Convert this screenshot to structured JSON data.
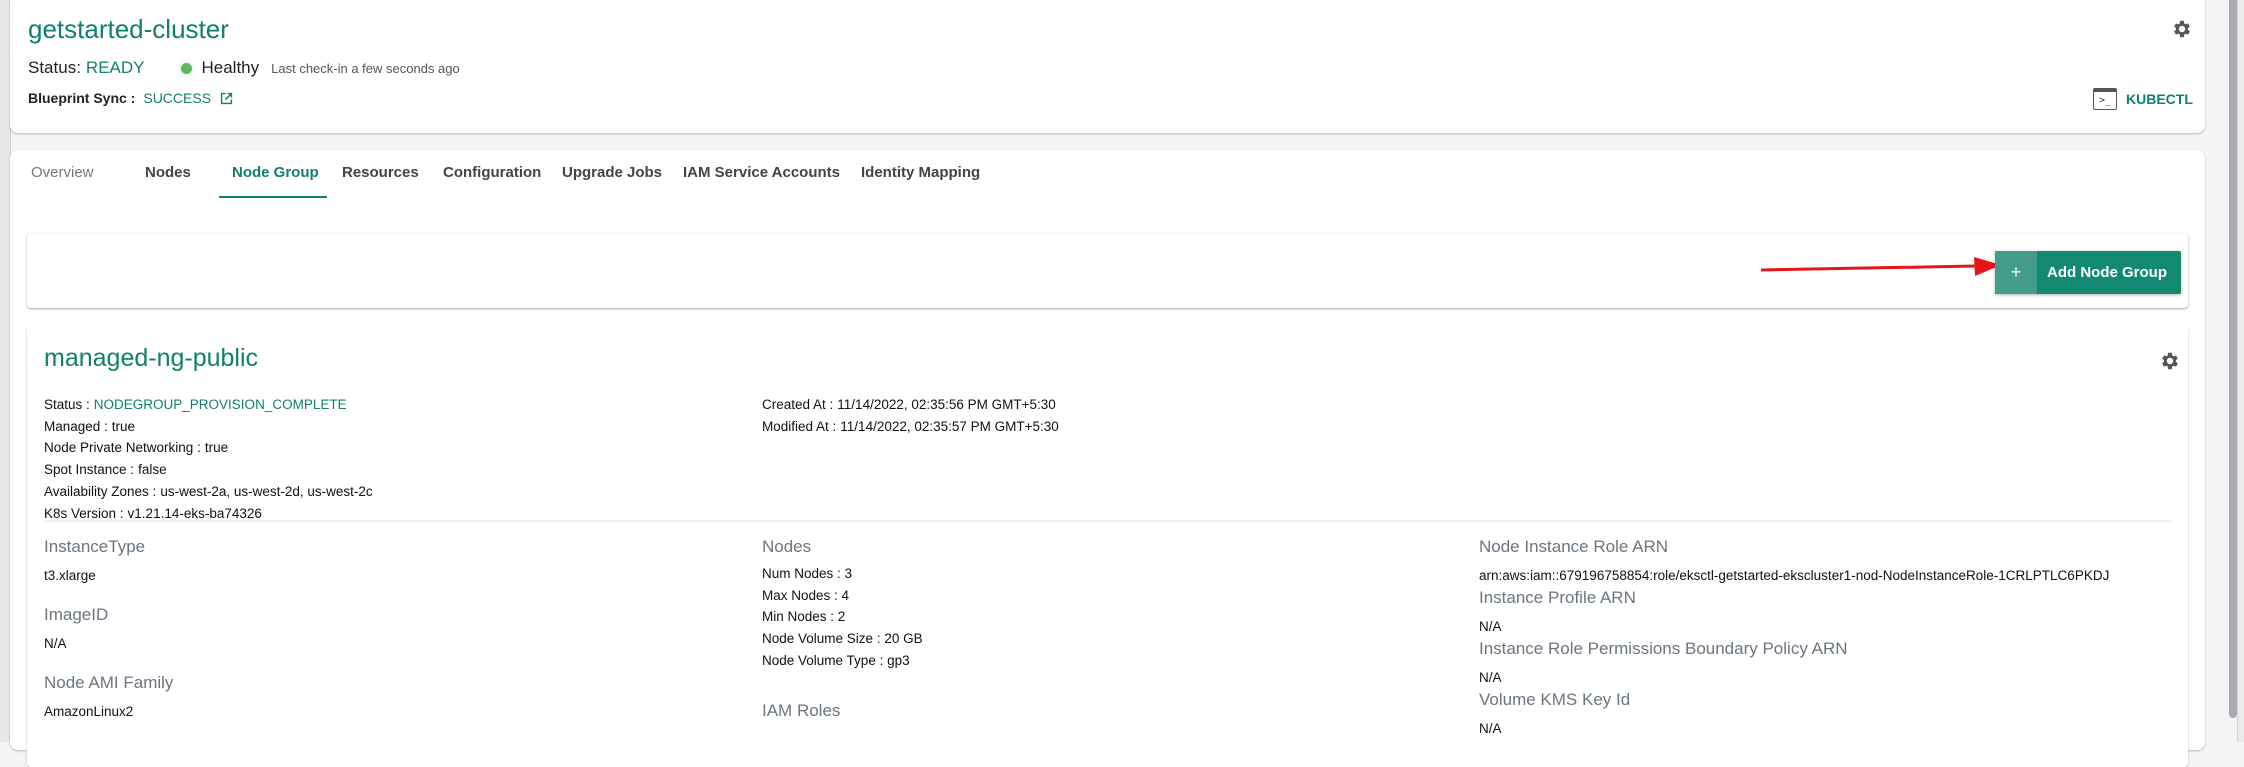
{
  "header": {
    "cluster_name": "getstarted-cluster",
    "status_label": "Status:",
    "status_value": "READY",
    "health": "Healthy",
    "health_color": "#5cb85c",
    "last_checkin": "Last check-in a few seconds ago",
    "blueprint_label": "Blueprint Sync :",
    "blueprint_value": "SUCCESS",
    "kubectl_label": "KUBECTL",
    "accent_color": "#11806a"
  },
  "tabs": [
    {
      "label": "Overview",
      "active": false
    },
    {
      "label": "Nodes",
      "active": false
    },
    {
      "label": "Node Group",
      "active": true
    },
    {
      "label": "Resources",
      "active": false
    },
    {
      "label": "Configuration",
      "active": false
    },
    {
      "label": "Upgrade Jobs",
      "active": false
    },
    {
      "label": "IAM Service Accounts",
      "active": false
    },
    {
      "label": "Identity Mapping",
      "active": false
    }
  ],
  "toolbar": {
    "add_icon": "+",
    "add_label": "Add Node Group",
    "annotation": "red-arrow-pointing-to-add-node-group"
  },
  "nodegroup": {
    "name": "managed-ng-public",
    "details_left": [
      {
        "key": "Status :",
        "value": "NODEGROUP_PROVISION_COMPLETE"
      },
      {
        "key": "Managed :",
        "value": "true"
      },
      {
        "key": "Node Private Networking :",
        "value": "true"
      },
      {
        "key": "Spot Instance :",
        "value": "false"
      },
      {
        "key": "Availability Zones :",
        "value": "us-west-2a, us-west-2d, us-west-2c"
      },
      {
        "key": "K8s Version :",
        "value": "v1.21.14-eks-ba74326"
      }
    ],
    "details_right": [
      {
        "key": "Created At :",
        "value": "11/14/2022, 02:35:56 PM GMT+5:30"
      },
      {
        "key": "Modified At :",
        "value": "11/14/2022, 02:35:57 PM GMT+5:30"
      }
    ],
    "instance_type": {
      "title": "InstanceType",
      "value": "t3.xlarge"
    },
    "image_id": {
      "title": "ImageID",
      "value": "N/A"
    },
    "ami_family": {
      "title": "Node AMI Family",
      "value": "AmazonLinux2"
    },
    "nodes": {
      "title": "Nodes",
      "items": [
        "Num Nodes : 3",
        "Max Nodes : 4",
        "Min Nodes : 2",
        "Node Volume Size :  20 GB",
        "Node Volume Type :  gp3"
      ]
    },
    "iam_roles": {
      "title": "IAM Roles"
    },
    "node_instance_role_arn": {
      "title": "Node Instance Role ARN",
      "value": "arn:aws:iam::679196758854:role/eksctl-getstarted-ekscluster1-nod-NodeInstanceRole-1CRLPTLC6PKDJ"
    },
    "instance_profile_arn": {
      "title": "Instance Profile ARN",
      "value": "N/A"
    },
    "permissions_boundary_arn": {
      "title": "Instance Role Permissions Boundary Policy ARN",
      "value": "N/A"
    },
    "volume_kms_key_id": {
      "title": "Volume KMS Key Id",
      "value": "N/A"
    }
  }
}
